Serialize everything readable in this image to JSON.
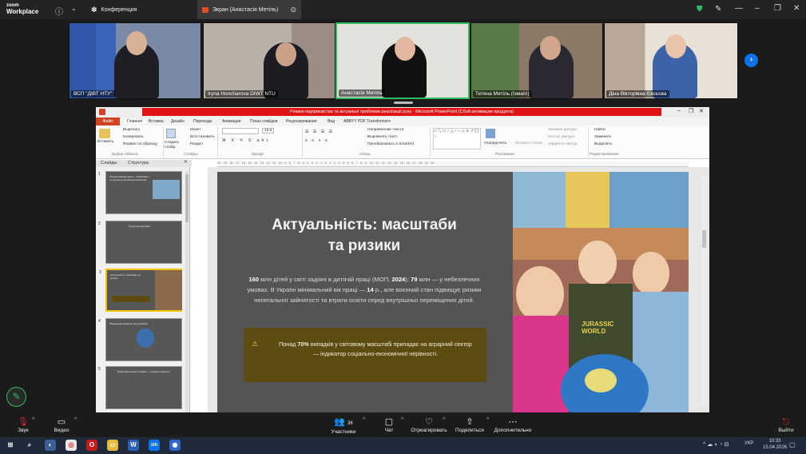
{
  "app": {
    "logo_top": "zoom",
    "logo_bottom": "Workplace"
  },
  "tabs": [
    {
      "label": "Конференция"
    },
    {
      "label": "Экран (Анастасія Метіль)"
    }
  ],
  "participants": [
    {
      "name": "ВСП \"ДІВТ НТУ\""
    },
    {
      "name": "Iryna Honcharova DIWT NTU"
    },
    {
      "name": "Анастасія Метіль"
    },
    {
      "name": "Тетяна Метіль (Ізмаїл)"
    },
    {
      "name": "Діна Вікторівна Євсєєва"
    }
  ],
  "ppt": {
    "title_bar": "Ризики підприємства та актуальні проблеми реалізації руху - Microsoft PowerPoint (Сбой активации продукта)",
    "tabs": [
      "Файл",
      "Главная",
      "Вставка",
      "Дизайн",
      "Переходы",
      "Анимация",
      "Показ слайдов",
      "Рецензирование",
      "Вид",
      "ABBYY PDF Transformer+"
    ],
    "ribbon": {
      "paste": "Вставить",
      "cut": "Вырезать",
      "copy": "Копировать",
      "format_painter": "Формат по образцу",
      "clipboard": "Буфер обмена",
      "layout": "Макет",
      "reset": "Восстановить",
      "section": "Раздел",
      "new_slide": "Создать слайд",
      "slides_group": "Слайды",
      "font_group": "Шрифт",
      "font_size": "15,5",
      "text_direction": "Направление текста",
      "align_text": "Выровнять текст",
      "smartart": "Преобразовать в SmartArt",
      "paragraph_group": "Абзац",
      "arrange": "Упорядочить",
      "quick_styles": "Экспресс-стили",
      "shape_fill": "Заливка фигуры",
      "shape_outline": "Контур фигуры",
      "shape_effects": "Эффекты фигур",
      "drawing_group": "Рисование",
      "find": "Найти",
      "replace": "Заменить",
      "select": "Выделить",
      "editing_group": "Редактирование"
    },
    "panel_tabs": [
      "Слайды",
      "Структура"
    ],
    "ruler": "20 · 19 · 18 · 17 · 16 · 15 · 14 · 13 · 12 · 11 · 10 · 9 · 8 · 7 · 6 · 5 · 4 · 3 · 2 · 1 · 0 · 1 · 2 · 3 · 4 · 5 · 6 · 7 · 8 · 9 · 10 · 11 · 12 · 13 · 14 · 15 · 16 · 17 · 18 · 19 · 20",
    "thumbnails": [
      {
        "num": "1",
        "text": "Ризики використання... особливості та актуальні проблеми реалізації"
      },
      {
        "num": "2",
        "text": "Структура доповіді"
      },
      {
        "num": "3",
        "text": "Актуальність: масштаби та ризики"
      },
      {
        "num": "4",
        "text": "Міжнародне правове регулювання"
      },
      {
        "num": "5",
        "text": "Правовий режим в Україні — основні елементи"
      }
    ]
  },
  "slide": {
    "title_line1": "Актуальність: масштаби",
    "title_line2": "та ризики",
    "body_b1": "160",
    "body_t1": " млн дітей у світі задіяні в дитячій праці (МОП, ",
    "body_b2": "2024",
    "body_t2": "); ",
    "body_b3": "79",
    "body_t3": " млн — у небезпечних умовах. В Україні мінімальний вік праці — ",
    "body_b4": "14",
    "body_t4": " р., але воєнний стан підвищує ризики нелегальної зайнятості та втрати освіти серед внутрішньо переміщених дітей.",
    "callout_t1": "Понад ",
    "callout_b": "70%",
    "callout_t2": " випадків у світовому масштабі припадає на аграрний сектор — індикатор соціально-економічної нерівності.",
    "photo_shirt_text": "JURASSIC WORLD"
  },
  "bottom_bar": {
    "audio": "Звук",
    "video": "Видео",
    "participants": "Участники",
    "participants_count": "36",
    "chat": "Чат",
    "react": "Отреагировать",
    "share": "Поделиться",
    "more": "Дополнительно",
    "leave": "Выйти"
  },
  "taskbar": {
    "lang": "УКР",
    "time": "10:33",
    "date": "15.04.2026"
  },
  "colors": {
    "accent": "#0e72ed",
    "speaker_border": "#2dbb5d",
    "callout": "#5c4c12",
    "slide_bg": "#545454",
    "leave": "#e02828"
  }
}
